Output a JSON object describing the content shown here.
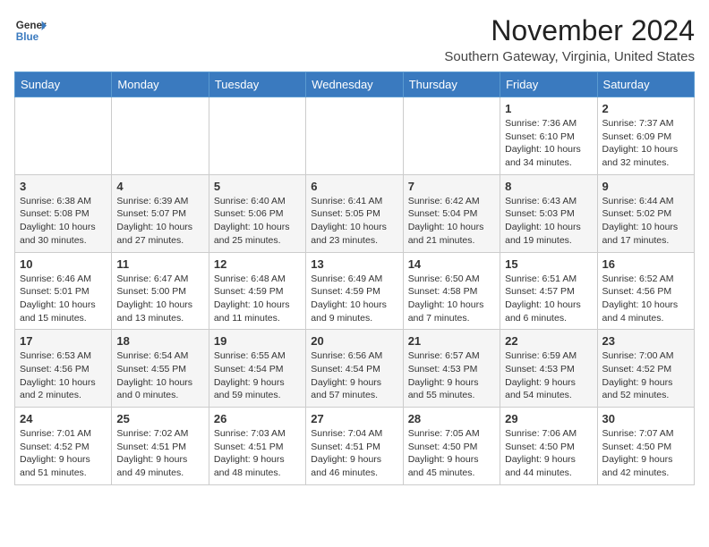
{
  "header": {
    "logo_line1": "General",
    "logo_line2": "Blue",
    "month": "November 2024",
    "location": "Southern Gateway, Virginia, United States"
  },
  "days": [
    "Sunday",
    "Monday",
    "Tuesday",
    "Wednesday",
    "Thursday",
    "Friday",
    "Saturday"
  ],
  "weeks": [
    [
      {
        "date": "",
        "info": ""
      },
      {
        "date": "",
        "info": ""
      },
      {
        "date": "",
        "info": ""
      },
      {
        "date": "",
        "info": ""
      },
      {
        "date": "",
        "info": ""
      },
      {
        "date": "1",
        "info": "Sunrise: 7:36 AM\nSunset: 6:10 PM\nDaylight: 10 hours\nand 34 minutes."
      },
      {
        "date": "2",
        "info": "Sunrise: 7:37 AM\nSunset: 6:09 PM\nDaylight: 10 hours\nand 32 minutes."
      }
    ],
    [
      {
        "date": "3",
        "info": "Sunrise: 6:38 AM\nSunset: 5:08 PM\nDaylight: 10 hours\nand 30 minutes."
      },
      {
        "date": "4",
        "info": "Sunrise: 6:39 AM\nSunset: 5:07 PM\nDaylight: 10 hours\nand 27 minutes."
      },
      {
        "date": "5",
        "info": "Sunrise: 6:40 AM\nSunset: 5:06 PM\nDaylight: 10 hours\nand 25 minutes."
      },
      {
        "date": "6",
        "info": "Sunrise: 6:41 AM\nSunset: 5:05 PM\nDaylight: 10 hours\nand 23 minutes."
      },
      {
        "date": "7",
        "info": "Sunrise: 6:42 AM\nSunset: 5:04 PM\nDaylight: 10 hours\nand 21 minutes."
      },
      {
        "date": "8",
        "info": "Sunrise: 6:43 AM\nSunset: 5:03 PM\nDaylight: 10 hours\nand 19 minutes."
      },
      {
        "date": "9",
        "info": "Sunrise: 6:44 AM\nSunset: 5:02 PM\nDaylight: 10 hours\nand 17 minutes."
      }
    ],
    [
      {
        "date": "10",
        "info": "Sunrise: 6:46 AM\nSunset: 5:01 PM\nDaylight: 10 hours\nand 15 minutes."
      },
      {
        "date": "11",
        "info": "Sunrise: 6:47 AM\nSunset: 5:00 PM\nDaylight: 10 hours\nand 13 minutes."
      },
      {
        "date": "12",
        "info": "Sunrise: 6:48 AM\nSunset: 4:59 PM\nDaylight: 10 hours\nand 11 minutes."
      },
      {
        "date": "13",
        "info": "Sunrise: 6:49 AM\nSunset: 4:59 PM\nDaylight: 10 hours\nand 9 minutes."
      },
      {
        "date": "14",
        "info": "Sunrise: 6:50 AM\nSunset: 4:58 PM\nDaylight: 10 hours\nand 7 minutes."
      },
      {
        "date": "15",
        "info": "Sunrise: 6:51 AM\nSunset: 4:57 PM\nDaylight: 10 hours\nand 6 minutes."
      },
      {
        "date": "16",
        "info": "Sunrise: 6:52 AM\nSunset: 4:56 PM\nDaylight: 10 hours\nand 4 minutes."
      }
    ],
    [
      {
        "date": "17",
        "info": "Sunrise: 6:53 AM\nSunset: 4:56 PM\nDaylight: 10 hours\nand 2 minutes."
      },
      {
        "date": "18",
        "info": "Sunrise: 6:54 AM\nSunset: 4:55 PM\nDaylight: 10 hours\nand 0 minutes."
      },
      {
        "date": "19",
        "info": "Sunrise: 6:55 AM\nSunset: 4:54 PM\nDaylight: 9 hours\nand 59 minutes."
      },
      {
        "date": "20",
        "info": "Sunrise: 6:56 AM\nSunset: 4:54 PM\nDaylight: 9 hours\nand 57 minutes."
      },
      {
        "date": "21",
        "info": "Sunrise: 6:57 AM\nSunset: 4:53 PM\nDaylight: 9 hours\nand 55 minutes."
      },
      {
        "date": "22",
        "info": "Sunrise: 6:59 AM\nSunset: 4:53 PM\nDaylight: 9 hours\nand 54 minutes."
      },
      {
        "date": "23",
        "info": "Sunrise: 7:00 AM\nSunset: 4:52 PM\nDaylight: 9 hours\nand 52 minutes."
      }
    ],
    [
      {
        "date": "24",
        "info": "Sunrise: 7:01 AM\nSunset: 4:52 PM\nDaylight: 9 hours\nand 51 minutes."
      },
      {
        "date": "25",
        "info": "Sunrise: 7:02 AM\nSunset: 4:51 PM\nDaylight: 9 hours\nand 49 minutes."
      },
      {
        "date": "26",
        "info": "Sunrise: 7:03 AM\nSunset: 4:51 PM\nDaylight: 9 hours\nand 48 minutes."
      },
      {
        "date": "27",
        "info": "Sunrise: 7:04 AM\nSunset: 4:51 PM\nDaylight: 9 hours\nand 46 minutes."
      },
      {
        "date": "28",
        "info": "Sunrise: 7:05 AM\nSunset: 4:50 PM\nDaylight: 9 hours\nand 45 minutes."
      },
      {
        "date": "29",
        "info": "Sunrise: 7:06 AM\nSunset: 4:50 PM\nDaylight: 9 hours\nand 44 minutes."
      },
      {
        "date": "30",
        "info": "Sunrise: 7:07 AM\nSunset: 4:50 PM\nDaylight: 9 hours\nand 42 minutes."
      }
    ]
  ]
}
